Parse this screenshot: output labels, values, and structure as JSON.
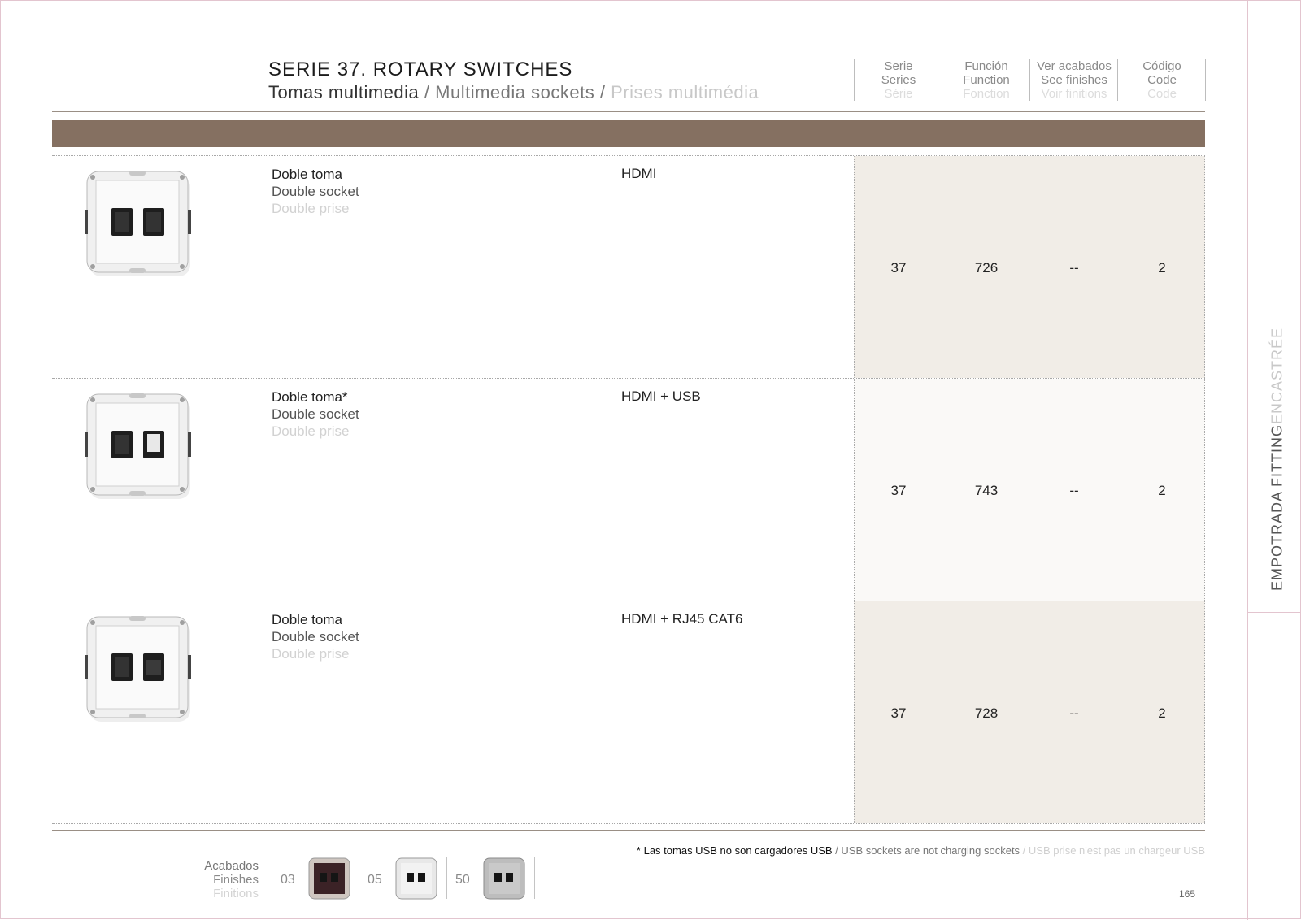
{
  "header": {
    "title": "SERIE 37. ROTARY SWITCHES",
    "subtitle_es": "Tomas multimedia",
    "subtitle_en": "Multimedia sockets",
    "subtitle_fr": "Prises multimédia",
    "separator": "/"
  },
  "columns": [
    {
      "es": "Serie",
      "en": "Series",
      "fr": "Série"
    },
    {
      "es": "Función",
      "en": "Function",
      "fr": "Fonction"
    },
    {
      "es": "Ver acabados",
      "en": "See finishes",
      "fr": "Voir finitions"
    },
    {
      "es": "Código",
      "en": "Code",
      "fr": "Code"
    }
  ],
  "rows": [
    {
      "desc_es": "Doble toma",
      "desc_en": "Double socket",
      "desc_fr": "Double prise",
      "function": "HDMI",
      "serie": "37",
      "funcion": "726",
      "acabados": "--",
      "codigo": "2"
    },
    {
      "desc_es": "Doble toma*",
      "desc_en": "Double socket",
      "desc_fr": "Double prise",
      "function": "HDMI + USB",
      "serie": "37",
      "funcion": "743",
      "acabados": "--",
      "codigo": "2"
    },
    {
      "desc_es": "Doble toma",
      "desc_en": "Double socket",
      "desc_fr": "Double prise",
      "function": "HDMI + RJ45 CAT6",
      "serie": "37",
      "funcion": "728",
      "acabados": "--",
      "codigo": "2"
    }
  ],
  "footnote": {
    "es": "* Las tomas USB no son cargadores USB",
    "en": "USB sockets are not charging sockets",
    "fr": "USB prise n'est pas un chargeur USB",
    "separator": " / "
  },
  "finishes": {
    "label_es": "Acabados",
    "label_en": "Finishes",
    "label_fr": "Finitions",
    "items": [
      {
        "code": "03",
        "color": "#3b2226"
      },
      {
        "code": "05",
        "color": "#f2f2f2"
      },
      {
        "code": "50",
        "color": "#c9c9c9"
      }
    ]
  },
  "side": {
    "es": "EMPOTRADA",
    "en": "FITTING",
    "fr": "ENCASTRÉE"
  },
  "page_number": "165",
  "colors": {
    "band": "#857061",
    "shade": "#f1ede7",
    "shade_alt": "#faf9f7"
  }
}
